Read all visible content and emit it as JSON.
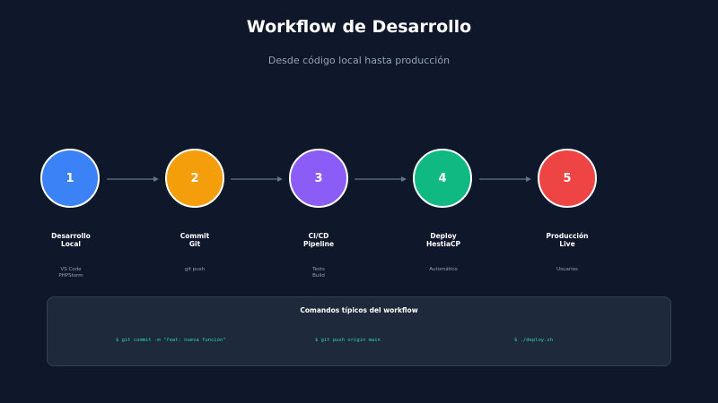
{
  "title": "Workflow de Desarrollo",
  "subtitle": "Desde código local hasta producción",
  "steps": [
    {
      "number": "1",
      "label": [
        "Desarrollo",
        "Local"
      ],
      "details": [
        "VS Code",
        "PHPStorm"
      ],
      "color": "#3b82f6"
    },
    {
      "number": "2",
      "label": [
        "Commit",
        "Git"
      ],
      "details": [
        "git push"
      ],
      "color": "#f59e0b"
    },
    {
      "number": "3",
      "label": [
        "CI/CD",
        "Pipeline"
      ],
      "details": [
        "Tests",
        "Build"
      ],
      "color": "#8b5cf6"
    },
    {
      "number": "4",
      "label": [
        "Deploy",
        "HestiaCP"
      ],
      "details": [
        "Automático"
      ],
      "color": "#10b981"
    },
    {
      "number": "5",
      "label": [
        "Producción",
        "Live"
      ],
      "details": [
        "Usuarios"
      ],
      "color": "#ef4444"
    }
  ],
  "commands_panel": {
    "title": "Comandos típicos del workflow",
    "commands": [
      "$ git commit -m \"feat: nueva función\"",
      "$ git push origin main",
      "$ ./deploy.sh"
    ]
  }
}
